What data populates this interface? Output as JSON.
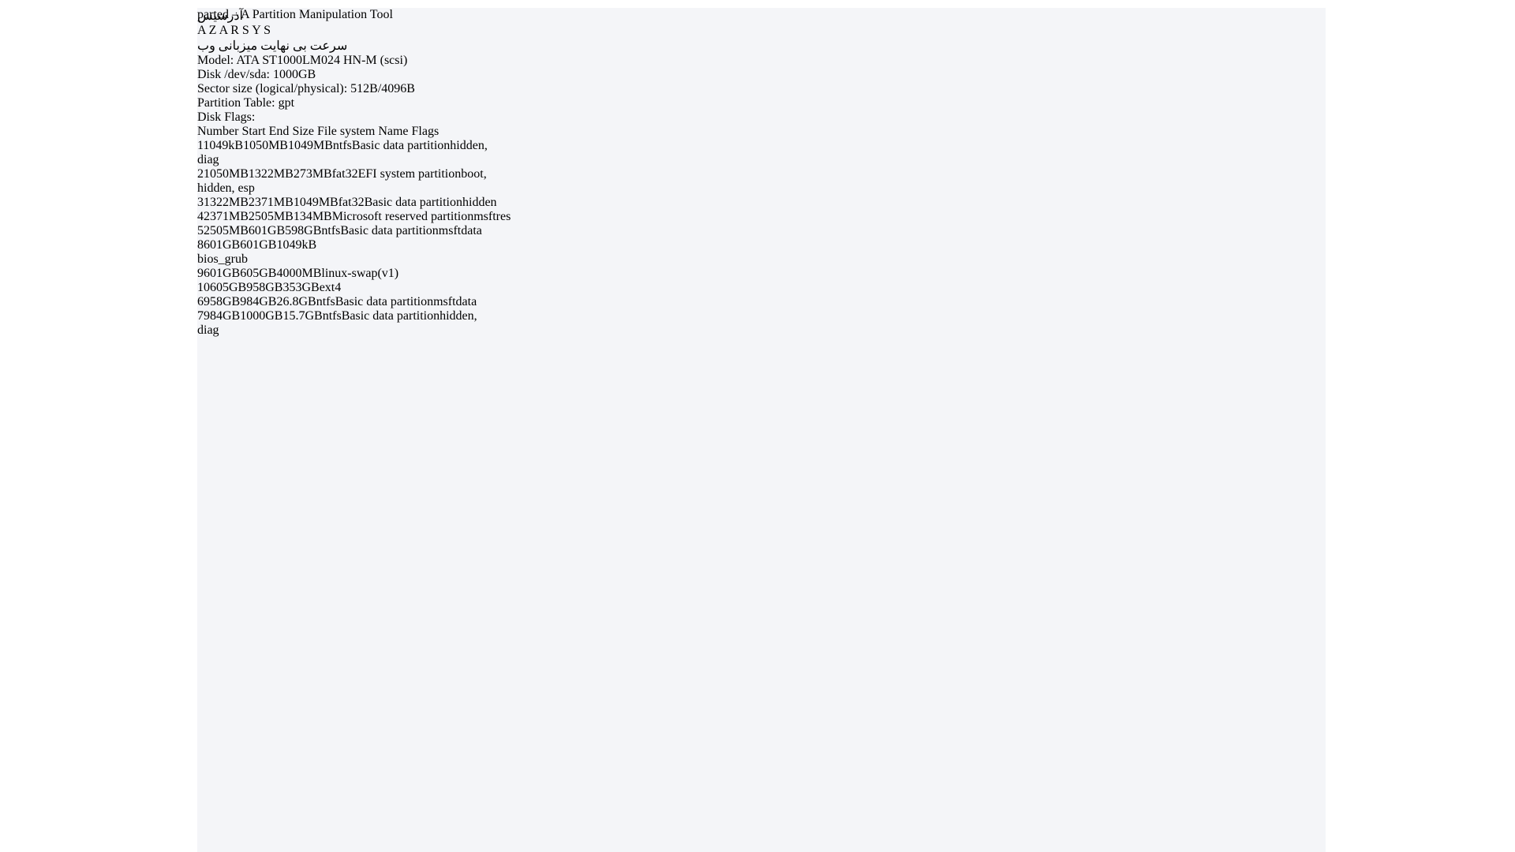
{
  "window": {
    "title": "parted – A Partition Manipulation Tool"
  },
  "terminal": {
    "info_lines": [
      "Model: ATA ST1000LM024 HN-M (scsi)",
      "Disk /dev/sda: 1000GB",
      "Sector size (logical/physical): 512B/4096B",
      "Partition Table: gpt",
      "Disk Flags:"
    ],
    "table": {
      "headers": {
        "number": "Number",
        "start": "Start",
        "end": "End",
        "size": "Size",
        "fs": "File system",
        "name": "Name",
        "flags": "Flags"
      },
      "rows": [
        {
          "number": "1",
          "start": "1049kB",
          "end": "1050MB",
          "size": "1049MB",
          "fs": "ntfs",
          "name": "Basic data partition",
          "flags": "hidden,",
          "wrap": "diag"
        },
        {
          "number": "2",
          "start": "1050MB",
          "end": "1322MB",
          "size": "273MB",
          "fs": "fat32",
          "name": "EFI system partition",
          "flags": "boot,",
          "wrap": "hidden, esp"
        },
        {
          "number": "3",
          "start": "1322MB",
          "end": "2371MB",
          "size": "1049MB",
          "fs": "fat32",
          "name": "Basic data partition",
          "flags": "hidden",
          "wrap": ""
        },
        {
          "number": "4",
          "start": "2371MB",
          "end": "2505MB",
          "size": "134MB",
          "fs": "",
          "name": "Microsoft reserved partition",
          "flags": "msftres",
          "wrap": ""
        },
        {
          "number": "5",
          "start": "2505MB",
          "end": "601GB",
          "size": "598GB",
          "fs": "ntfs",
          "name": "Basic data partition",
          "flags": "msftdata",
          "wrap": ""
        },
        {
          "number": "8",
          "start": "601GB",
          "end": "601GB",
          "size": "1049kB",
          "fs": "",
          "name": "",
          "flags": "",
          "wrap": "bios_grub"
        },
        {
          "number": "9",
          "start": "601GB",
          "end": "605GB",
          "size": "4000MB",
          "fs": "linux-swap(v1)",
          "name": "",
          "flags": "",
          "wrap": ""
        },
        {
          "number": "10",
          "start": "605GB",
          "end": "958GB",
          "size": "353GB",
          "fs": "ext4",
          "name": "",
          "flags": "",
          "wrap": ""
        },
        {
          "number": "6",
          "start": "958GB",
          "end": "984GB",
          "size": "26.8GB",
          "fs": "ntfs",
          "name": "Basic data partition",
          "flags": "msftdata",
          "wrap": ""
        },
        {
          "number": "7",
          "start": "984GB",
          "end": "1000GB",
          "size": "15.7GB",
          "fs": "ntfs",
          "name": "Basic data partition",
          "flags": "hidden,",
          "wrap": "diag"
        }
      ]
    }
  },
  "watermark": {
    "latin": "A Z A R   S Y S",
    "persian_big": "آذرسیس",
    "persian_tagline": "سرعت بی نهایت میزبانی وب"
  }
}
